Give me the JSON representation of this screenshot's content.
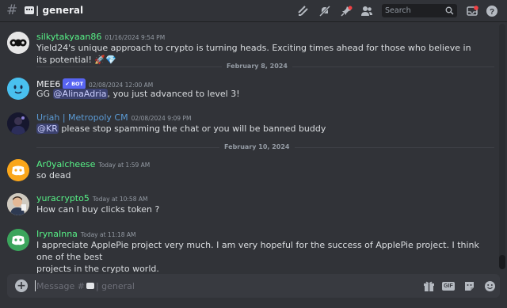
{
  "channel": {
    "hash": "#",
    "name": "| general"
  },
  "toolbar": {
    "search_placeholder": "Search",
    "icons": [
      "threads-icon",
      "mute-icon",
      "pin-icon",
      "members-icon",
      "search-icon",
      "inbox-icon",
      "help-icon"
    ]
  },
  "messages": [
    {
      "author": "silkytakyaan86",
      "author_color": "#57f287",
      "timestamp": "01/16/2024 9:54 PM",
      "text": "Yield24's unique approach to crypto is turning heads. Exciting times ahead for those who believe in its potential! 🚀💎"
    },
    {
      "date_divider": "February 8, 2024"
    },
    {
      "author": "MEE6",
      "bot_badge": "✔ BOT",
      "author_color": "#f2f3f5",
      "timestamp": "02/08/2024 12:00 AM",
      "text_before": "GG ",
      "mention": "@AlinaAdria",
      "text_after": ", you just advanced to level 3!"
    },
    {
      "author": "Uriah | Metropoly CM",
      "author_color": "#5b9bd5",
      "timestamp": "02/08/2024 9:09 PM",
      "mention": "@KR",
      "text_after": " please stop spamming the chat or you will be banned buddy"
    },
    {
      "date_divider": "February 10, 2024"
    },
    {
      "author": "Ar0yalcheese",
      "author_color": "#57f287",
      "timestamp": "Today at 1:59 AM",
      "text": "so dead"
    },
    {
      "author": "yuracrypto5",
      "author_color": "#57f287",
      "timestamp": "Today at 10:58 AM",
      "text": "How can I buy clicks token ?"
    },
    {
      "author": "IrynaInna",
      "author_color": "#57f287",
      "timestamp": "Today at 11:18 AM",
      "text_line1": "I appreciate ApplePie project very much. I am very hopeful for the success of ApplePie project. I think one of the best",
      "text_line2": "projects in the crypto world."
    }
  ],
  "composer": {
    "placeholder_prefix": "Message #",
    "placeholder_suffix": "| general",
    "gif_label": "GIF"
  },
  "colors": {
    "background": "#313338",
    "blurple": "#5865f2",
    "green_name": "#57f287",
    "orange_avatar": "#faa61a",
    "green_avatar": "#3ba55c"
  }
}
